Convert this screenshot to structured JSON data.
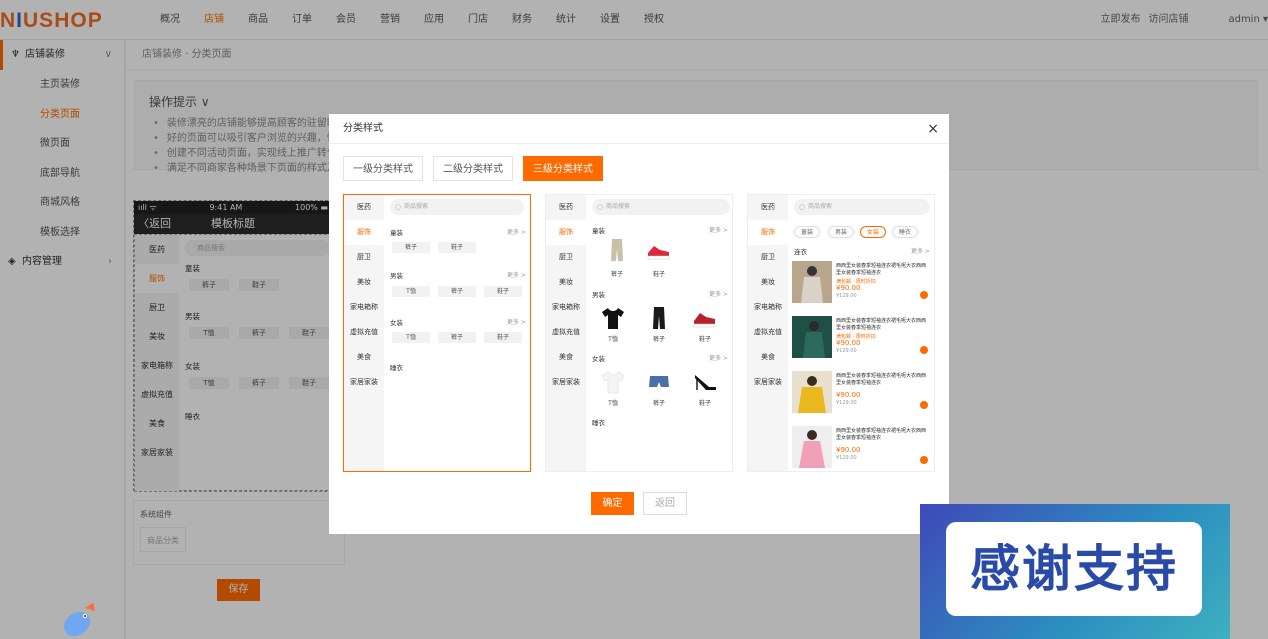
{
  "logo": "NIUSHOP",
  "nav": [
    "概况",
    "店铺",
    "商品",
    "订单",
    "会员",
    "营销",
    "应用",
    "门店",
    "财务",
    "统计",
    "设置",
    "授权"
  ],
  "nav_active": 1,
  "top_right": {
    "publish": "立即发布",
    "visit": "访问店铺",
    "user": "admin ▾"
  },
  "sidebar": {
    "group1": "店铺装修",
    "items": [
      "主页装修",
      "分类页面",
      "微页面",
      "底部导航",
      "商城风格",
      "模板选择"
    ],
    "active_item": 1,
    "group2": "内容管理"
  },
  "breadcrumb": "店铺装修  ·  分类页面",
  "tips": {
    "title": "操作提示 ∨",
    "lines": [
      "装修漂亮的店铺能够提高顾客的驻留时间",
      "好的页面可以吸引客户浏览的兴趣，快速",
      "创建不同活动页面，实现线上推广转化。",
      "满足不同商家各种场景下页面的样式及排"
    ]
  },
  "phone": {
    "status_left": "ııll ᯤ",
    "status_time": "9:41 AM",
    "status_right": "100% ▬",
    "back": "〈返回",
    "title": "模板标题",
    "categories": [
      "医药",
      "服饰",
      "厨卫",
      "美妆",
      "家电箱称",
      "虚拟充值",
      "美食",
      "家居家装"
    ],
    "active": 1,
    "search": "商品搜索",
    "sections": [
      {
        "name": "童装",
        "chips": [
          "裤子",
          "鞋子"
        ]
      },
      {
        "name": "男装",
        "chips": [
          "T恤",
          "裤子",
          "鞋子"
        ]
      },
      {
        "name": "女装",
        "chips": [
          "T恤",
          "裤子",
          "鞋子"
        ]
      },
      {
        "name": "睡衣",
        "chips": []
      }
    ]
  },
  "components": {
    "title": "系统组件",
    "item": "商品分类"
  },
  "save": "保存",
  "modal": {
    "title": "分类样式",
    "close": "×",
    "tabs": [
      "一级分类样式",
      "二级分类样式",
      "三级分类样式"
    ],
    "active_tab": 2,
    "categories": [
      "医药",
      "服饰",
      "厨卫",
      "美妆",
      "家电箱称",
      "虚拟充值",
      "美食",
      "家居家装"
    ],
    "search": "商品搜索",
    "more": "更多 >",
    "p1_sections": [
      {
        "name": "童装",
        "chips": [
          "裤子",
          "鞋子"
        ]
      },
      {
        "name": "男装",
        "chips": [
          "T恤",
          "裤子",
          "鞋子"
        ]
      },
      {
        "name": "女装",
        "chips": [
          "T恤",
          "裤子",
          "鞋子"
        ]
      },
      {
        "name": "睡衣",
        "chips": []
      }
    ],
    "p2_sections": [
      {
        "name": "童装",
        "items": [
          "裤子",
          "鞋子"
        ]
      },
      {
        "name": "男装",
        "items": [
          "T恤",
          "裤子",
          "鞋子"
        ]
      },
      {
        "name": "女装",
        "items": [
          "T恤",
          "裤子",
          "鞋子"
        ]
      },
      {
        "name": "睡衣",
        "items": []
      }
    ],
    "p3_subtabs": [
      "童装",
      "男装",
      "女装",
      "睡衣"
    ],
    "p3_subtab_active": 2,
    "p3_section": "连衣",
    "p3_products": [
      {
        "name": "西西里女装春季短袖连衣裙毛呢大衣西西里女装春季短袖连衣",
        "tag": "满包邮 · 限时折扣",
        "price": "¥90.00",
        "old": "¥129.00"
      },
      {
        "name": "西西里女装春季短袖连衣裙毛呢大衣西西里女装春季短袖连衣",
        "tag": "满包邮 · 限时折扣",
        "price": "¥90.00",
        "old": "¥129.00"
      },
      {
        "name": "西西里女装春季短袖连衣裙毛呢大衣西西里女装春季短袖连衣",
        "tag": "",
        "price": "¥90.00",
        "old": "¥129.00"
      },
      {
        "name": "西西里女装春季短袖连衣裙毛呢大衣西西里女装春季短袖连衣",
        "tag": "",
        "price": "¥90.00",
        "old": "¥129.00"
      }
    ],
    "ok": "确定",
    "back": "返回"
  },
  "thanks": "感谢支持",
  "colors": {
    "accent": "#ff6a00",
    "logo_blue": "#2b6cc4"
  }
}
